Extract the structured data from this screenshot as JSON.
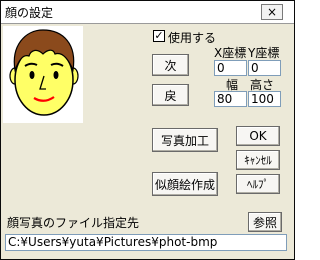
{
  "window": {
    "title": "顔の設定",
    "close_glyph": "×"
  },
  "use_checkbox": {
    "checked": true,
    "mark": "✓",
    "label": "使用する"
  },
  "coords": {
    "x_label": "X座標",
    "y_label": "Y座標",
    "x_value": "0",
    "y_value": "0",
    "w_label": "幅",
    "h_label": "高さ",
    "w_value": "80",
    "h_value": "100"
  },
  "buttons": {
    "next": "次",
    "prev": "戻",
    "photo_process": "写真加工",
    "ok": "OK",
    "cancel": "ｷｬﾝｾﾙ",
    "help": "ﾍﾙﾌﾟ",
    "make_face": "似顔絵作成",
    "browse": "参照"
  },
  "file": {
    "label": "顔写真のファイル指定先",
    "path": "C:¥Users¥yuta¥Pictures¥phot-bmp"
  },
  "face_preview": {
    "icon": "cartoon-face-icon",
    "skin": "#ffff66",
    "hair": "#8b4a1c",
    "mouth": "#ff0000"
  }
}
